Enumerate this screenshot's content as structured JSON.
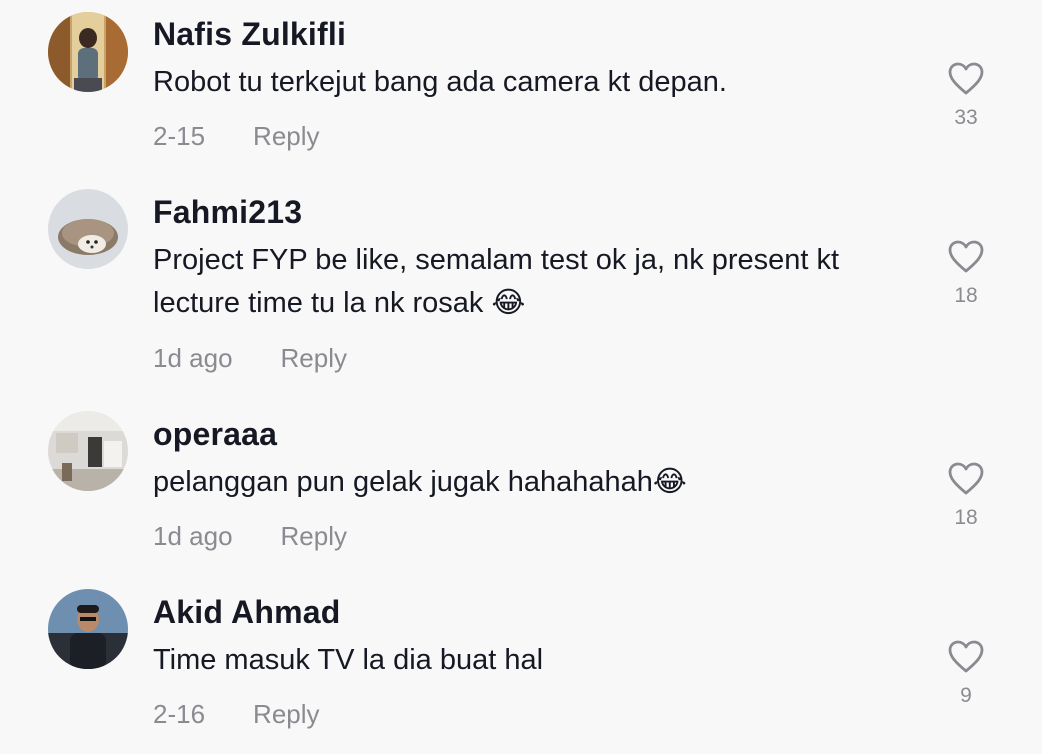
{
  "comments": [
    {
      "username": "Nafis Zulkifli",
      "text": "Robot tu terkejut bang ada camera kt depan.",
      "time": "2-15",
      "reply_label": "Reply",
      "likes": "33",
      "avatar_icon": "avatar-person-icon"
    },
    {
      "username": "Fahmi213",
      "text": "Project FYP be like, semalam test ok ja, nk present kt lecture time tu la nk rosak 😂",
      "time": "1d ago",
      "reply_label": "Reply",
      "likes": "18",
      "avatar_icon": "avatar-hedgehog-icon"
    },
    {
      "username": "operaaa",
      "text": "pelanggan pun gelak jugak hahahahah😂",
      "time": "1d ago",
      "reply_label": "Reply",
      "likes": "18",
      "avatar_icon": "avatar-room-icon"
    },
    {
      "username": "Akid Ahmad",
      "text": "Time masuk TV la dia buat hal",
      "time": "2-16",
      "reply_label": "Reply",
      "likes": "9",
      "avatar_icon": "avatar-person-icon"
    }
  ],
  "colors": {
    "background": "#f8f8f8",
    "primary_text": "#161823",
    "secondary_text": "#8a8b91"
  }
}
